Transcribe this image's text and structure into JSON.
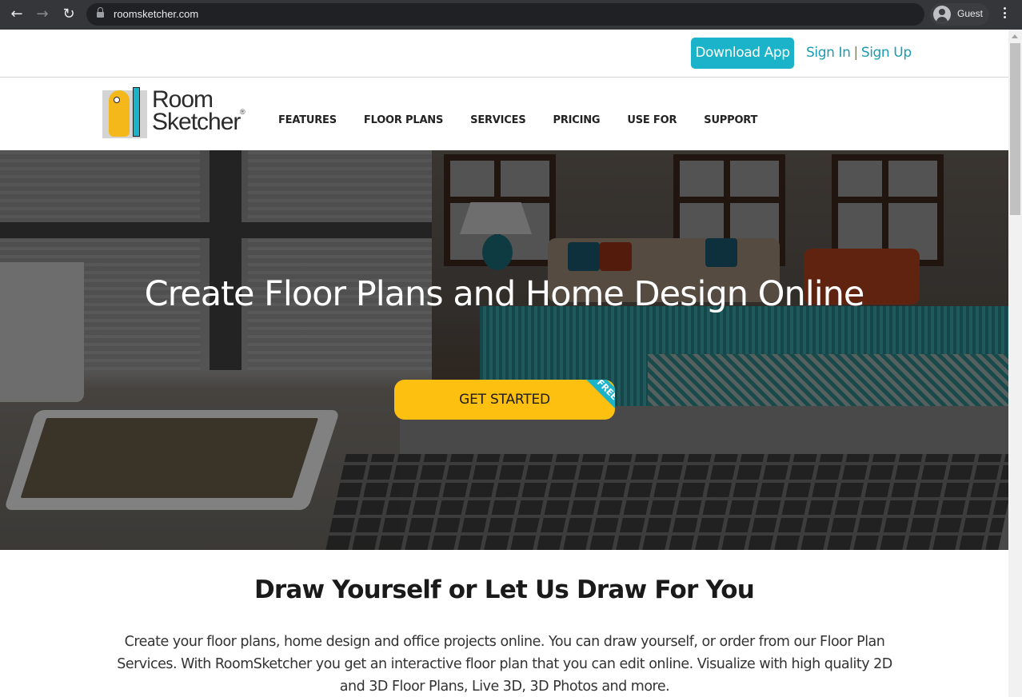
{
  "browser": {
    "url": "roomsketcher.com",
    "profile_label": "Guest"
  },
  "topbar": {
    "download_label": "Download App",
    "sign_in_label": "Sign In",
    "separator": "|",
    "sign_up_label": "Sign Up"
  },
  "header": {
    "logo_line1": "Room",
    "logo_line2": "Sketcher",
    "logo_reg": "®",
    "nav": [
      {
        "label": "FEATURES"
      },
      {
        "label": "FLOOR PLANS"
      },
      {
        "label": "SERVICES"
      },
      {
        "label": "PRICING"
      },
      {
        "label": "USE FOR"
      },
      {
        "label": "SUPPORT"
      }
    ]
  },
  "hero": {
    "title": "Create Floor Plans and Home Design Online",
    "cta_label": "GET STARTED",
    "cta_badge": "FREE"
  },
  "section": {
    "title": "Draw Yourself or Let Us Draw For You",
    "body": "Create your floor plans, home design and office projects online. You can draw yourself, or order from our Floor Plan Services. With RoomSketcher you get an interactive floor plan that you can edit online. Visualize with high quality 2D and 3D Floor Plans, Live 3D, 3D Photos and more."
  },
  "colors": {
    "accent_teal": "#1ab3c9",
    "cta_yellow": "#fdc010",
    "link_teal": "#1a9db4"
  }
}
